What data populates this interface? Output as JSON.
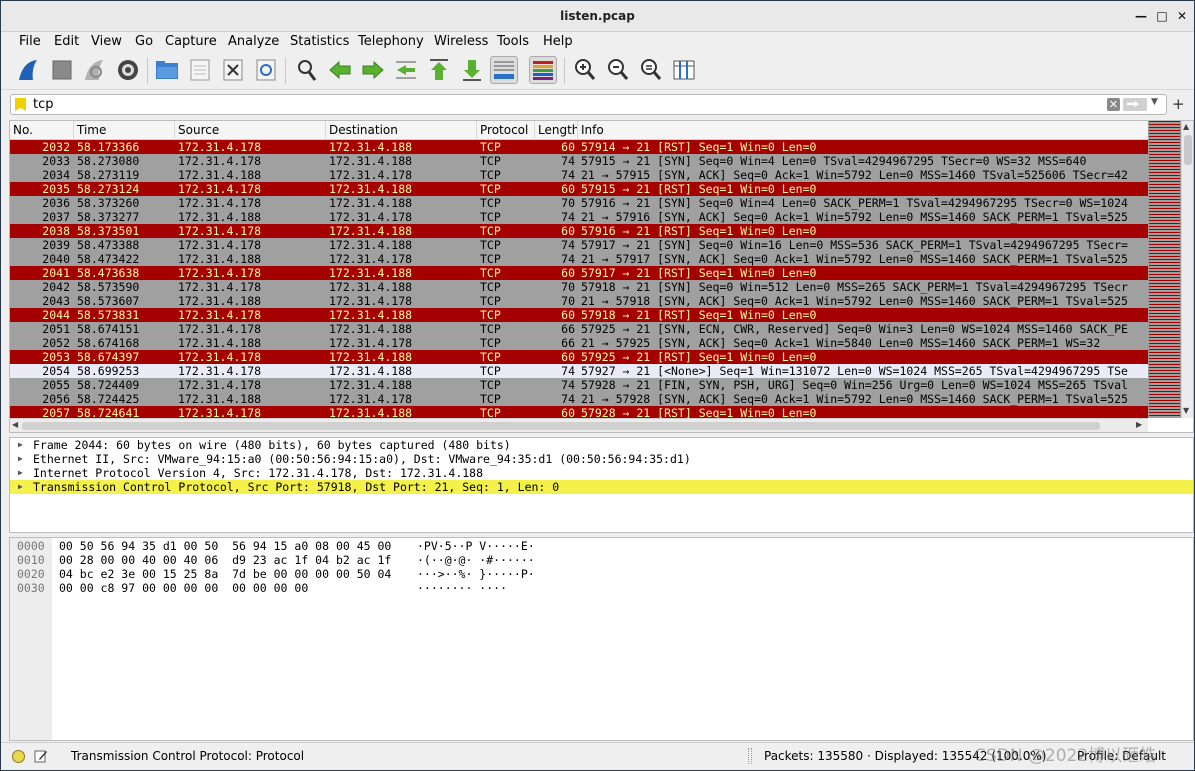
{
  "window": {
    "title": "listen.pcap"
  },
  "menu": [
    "File",
    "Edit",
    "View",
    "Go",
    "Capture",
    "Analyze",
    "Statistics",
    "Telephony",
    "Wireless",
    "Tools",
    "Help"
  ],
  "toolbar_icons": [
    "start-capture-icon",
    "stop-capture-icon",
    "restart-capture-icon",
    "capture-options-icon",
    "open-file-icon",
    "save-file-icon",
    "close-file-icon",
    "reload-file-icon",
    "find-packet-icon",
    "go-back-icon",
    "go-forward-icon",
    "go-to-packet-icon",
    "go-first-icon",
    "go-last-icon",
    "auto-scroll-icon",
    "colorize-icon",
    "zoom-in-icon",
    "zoom-out-icon",
    "zoom-normal-icon",
    "resize-columns-icon"
  ],
  "filter": {
    "value": "tcp"
  },
  "columns": [
    "No.",
    "Time",
    "Source",
    "Destination",
    "Protocol",
    "Length",
    "Info"
  ],
  "packets": [
    {
      "no": "2032",
      "time": "58.173366",
      "src": "172.31.4.178",
      "dst": "172.31.4.188",
      "proto": "TCP",
      "len": "60",
      "info": "57914 → 21 [RST] Seq=1 Win=0 Len=0",
      "style": "rst"
    },
    {
      "no": "2033",
      "time": "58.273080",
      "src": "172.31.4.178",
      "dst": "172.31.4.188",
      "proto": "TCP",
      "len": "74",
      "info": "57915 → 21 [SYN] Seq=0 Win=4 Len=0 TSval=4294967295 TSecr=0 WS=32 MSS=640",
      "style": "syn"
    },
    {
      "no": "2034",
      "time": "58.273119",
      "src": "172.31.4.188",
      "dst": "172.31.4.178",
      "proto": "TCP",
      "len": "74",
      "info": "21 → 57915 [SYN, ACK] Seq=0 Ack=1 Win=5792 Len=0 MSS=1460 TSval=525606 TSecr=42",
      "style": "syn"
    },
    {
      "no": "2035",
      "time": "58.273124",
      "src": "172.31.4.178",
      "dst": "172.31.4.188",
      "proto": "TCP",
      "len": "60",
      "info": "57915 → 21 [RST] Seq=1 Win=0 Len=0",
      "style": "rst"
    },
    {
      "no": "2036",
      "time": "58.373260",
      "src": "172.31.4.178",
      "dst": "172.31.4.188",
      "proto": "TCP",
      "len": "70",
      "info": "57916 → 21 [SYN] Seq=0 Win=4 Len=0 SACK_PERM=1 TSval=4294967295 TSecr=0 WS=1024",
      "style": "syn"
    },
    {
      "no": "2037",
      "time": "58.373277",
      "src": "172.31.4.188",
      "dst": "172.31.4.178",
      "proto": "TCP",
      "len": "74",
      "info": "21 → 57916 [SYN, ACK] Seq=0 Ack=1 Win=5792 Len=0 MSS=1460 SACK_PERM=1 TSval=525",
      "style": "syn"
    },
    {
      "no": "2038",
      "time": "58.373501",
      "src": "172.31.4.178",
      "dst": "172.31.4.188",
      "proto": "TCP",
      "len": "60",
      "info": "57916 → 21 [RST] Seq=1 Win=0 Len=0",
      "style": "rst"
    },
    {
      "no": "2039",
      "time": "58.473388",
      "src": "172.31.4.178",
      "dst": "172.31.4.188",
      "proto": "TCP",
      "len": "74",
      "info": "57917 → 21 [SYN] Seq=0 Win=16 Len=0 MSS=536 SACK_PERM=1 TSval=4294967295 TSecr=",
      "style": "syn"
    },
    {
      "no": "2040",
      "time": "58.473422",
      "src": "172.31.4.188",
      "dst": "172.31.4.178",
      "proto": "TCP",
      "len": "74",
      "info": "21 → 57917 [SYN, ACK] Seq=0 Ack=1 Win=5792 Len=0 MSS=1460 SACK_PERM=1 TSval=525",
      "style": "syn"
    },
    {
      "no": "2041",
      "time": "58.473638",
      "src": "172.31.4.178",
      "dst": "172.31.4.188",
      "proto": "TCP",
      "len": "60",
      "info": "57917 → 21 [RST] Seq=1 Win=0 Len=0",
      "style": "rst"
    },
    {
      "no": "2042",
      "time": "58.573590",
      "src": "172.31.4.178",
      "dst": "172.31.4.188",
      "proto": "TCP",
      "len": "70",
      "info": "57918 → 21 [SYN] Seq=0 Win=512 Len=0 MSS=265 SACK_PERM=1 TSval=4294967295 TSecr",
      "style": "syn"
    },
    {
      "no": "2043",
      "time": "58.573607",
      "src": "172.31.4.188",
      "dst": "172.31.4.178",
      "proto": "TCP",
      "len": "70",
      "info": "21 → 57918 [SYN, ACK] Seq=0 Ack=1 Win=5792 Len=0 MSS=1460 SACK_PERM=1 TSval=525",
      "style": "syn"
    },
    {
      "no": "2044",
      "time": "58.573831",
      "src": "172.31.4.178",
      "dst": "172.31.4.188",
      "proto": "TCP",
      "len": "60",
      "info": "57918 → 21 [RST] Seq=1 Win=0 Len=0",
      "style": "rst"
    },
    {
      "no": "2051",
      "time": "58.674151",
      "src": "172.31.4.178",
      "dst": "172.31.4.188",
      "proto": "TCP",
      "len": "66",
      "info": "57925 → 21 [SYN, ECN, CWR, Reserved] Seq=0 Win=3 Len=0 WS=1024 MSS=1460 SACK_PE",
      "style": "syn"
    },
    {
      "no": "2052",
      "time": "58.674168",
      "src": "172.31.4.188",
      "dst": "172.31.4.178",
      "proto": "TCP",
      "len": "66",
      "info": "21 → 57925 [SYN, ACK] Seq=0 Ack=1 Win=5840 Len=0 MSS=1460 SACK_PERM=1 WS=32",
      "style": "syn"
    },
    {
      "no": "2053",
      "time": "58.674397",
      "src": "172.31.4.178",
      "dst": "172.31.4.188",
      "proto": "TCP",
      "len": "60",
      "info": "57925 → 21 [RST] Seq=1 Win=0 Len=0",
      "style": "rst"
    },
    {
      "no": "2054",
      "time": "58.699253",
      "src": "172.31.4.178",
      "dst": "172.31.4.188",
      "proto": "TCP",
      "len": "74",
      "info": "57927 → 21 [<None>] Seq=1 Win=131072 Len=0 WS=1024 MSS=265 TSval=4294967295 TSe",
      "style": "sel"
    },
    {
      "no": "2055",
      "time": "58.724409",
      "src": "172.31.4.178",
      "dst": "172.31.4.188",
      "proto": "TCP",
      "len": "74",
      "info": "57928 → 21 [FIN, SYN, PSH, URG] Seq=0 Win=256 Urg=0 Len=0 WS=1024 MSS=265 TSval",
      "style": "syn"
    },
    {
      "no": "2056",
      "time": "58.724425",
      "src": "172.31.4.188",
      "dst": "172.31.4.178",
      "proto": "TCP",
      "len": "74",
      "info": "21 → 57928 [SYN, ACK] Seq=0 Ack=1 Win=5792 Len=0 MSS=1460 SACK_PERM=1 TSval=525",
      "style": "syn"
    },
    {
      "no": "2057",
      "time": "58.724641",
      "src": "172.31.4.178",
      "dst": "172.31.4.188",
      "proto": "TCP",
      "len": "60",
      "info": "57928 → 21 [RST] Seq=1 Win=0 Len=0",
      "style": "rst"
    }
  ],
  "details": [
    "Frame 2044: 60 bytes on wire (480 bits), 60 bytes captured (480 bits)",
    "Ethernet II, Src: VMware_94:15:a0 (00:50:56:94:15:a0), Dst: VMware_94:35:d1 (00:50:56:94:35:d1)",
    "Internet Protocol Version 4, Src: 172.31.4.178, Dst: 172.31.4.188",
    "Transmission Control Protocol, Src Port: 57918, Dst Port: 21, Seq: 1, Len: 0"
  ],
  "bytes": [
    {
      "off": "0000",
      "hex": "00 50 56 94 35 d1 00 50  56 94 15 a0 08 00 45 00",
      "ascii": "·PV·5··P V·····E·"
    },
    {
      "off": "0010",
      "hex": "00 28 00 00 40 00 40 06  d9 23 ac 1f 04 b2 ac 1f",
      "ascii": "·(··@·@· ·#······"
    },
    {
      "off": "0020",
      "hex": "04 bc e2 3e 00 15 25 8a  7d be 00 00 00 00 50 04",
      "ascii": "···>··%· }·····P·"
    },
    {
      "off": "0030",
      "hex": "00 00 c8 97 00 00 00 00  00 00 00 00",
      "ascii": "········ ····"
    }
  ],
  "status": {
    "message": "Transmission Control Protocol: Protocol",
    "packets": "Packets: 135580 · Displayed: 135542 (100.0%)",
    "profile": "Profile: Default"
  },
  "watermark": "CSDN @2022博以砸皓",
  "colors": {
    "rst_bg": "#a40000",
    "rst_fg": "#fffc9c",
    "syn_bg": "#a0a0a0",
    "highlight": "#f4f24a"
  }
}
